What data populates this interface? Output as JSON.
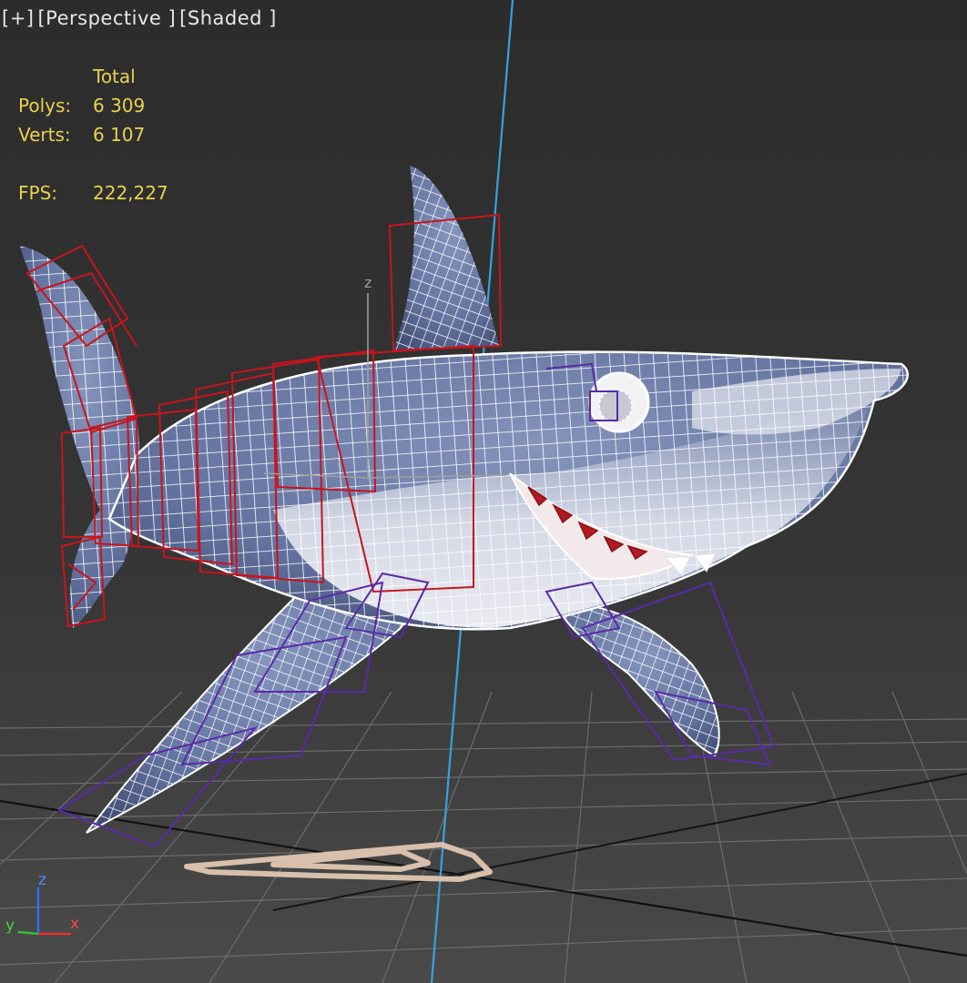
{
  "viewport": {
    "menu_plus": "[+]",
    "menu_view": "[Perspective ]",
    "menu_shading": "[Shaded ]"
  },
  "stats": {
    "header": "Total",
    "polys_label": "Polys:",
    "polys_value": "6 309",
    "verts_label": "Verts:",
    "verts_value": "6 107",
    "fps_label": "FPS:",
    "fps_value": "222,227"
  },
  "gizmo": {
    "z_label": "z",
    "x_label": "x",
    "y_label": "y",
    "pivot_z_label": "z"
  },
  "colors": {
    "stats_text": "#e8d24a",
    "z_axis_line": "#39a0e0",
    "bone_red": "#c8141e",
    "bone_purple": "#5a2aa8",
    "shark_body": "#6f80a8",
    "wire": "#ffffff"
  }
}
